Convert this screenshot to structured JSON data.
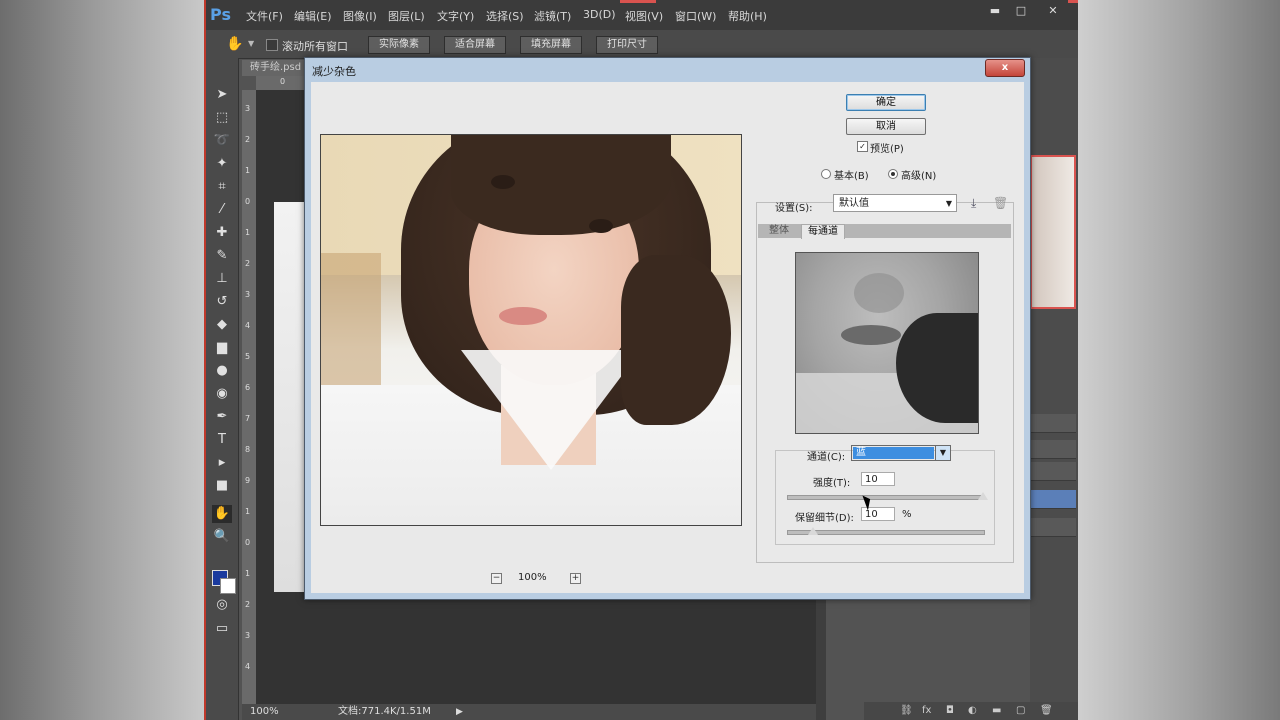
{
  "app": {
    "logo": "Ps",
    "menu": [
      "文件(F)",
      "编辑(E)",
      "图像(I)",
      "图层(L)",
      "文字(Y)",
      "选择(S)",
      "滤镜(T)",
      "3D(D)",
      "视图(V)",
      "窗口(W)",
      "帮助(H)"
    ],
    "window_controls": [
      "▬",
      "□",
      "✕"
    ]
  },
  "options_bar": {
    "scroll_all_label": "滚动所有窗口",
    "buttons": [
      "实际像素",
      "适合屏幕",
      "填充屏幕",
      "打印尺寸"
    ]
  },
  "document": {
    "tab_label": "砖手绘.psd",
    "ruler_v_ticks": [
      "3",
      "2",
      "1",
      "0",
      "1",
      "2",
      "3",
      "4",
      "5",
      "6",
      "7",
      "8",
      "9",
      "1",
      "0",
      "1",
      "2",
      "3",
      "4"
    ],
    "ruler_h_first": "0"
  },
  "status_bar": {
    "zoom": "100%",
    "doc_info": "文档:771.4K/1.51M",
    "arrow": "▶"
  },
  "dialog": {
    "title": "减少杂色",
    "close_label": "x",
    "ok_label": "确定",
    "cancel_label": "取消",
    "preview_label": "预览(P)",
    "preview_checked": true,
    "mode_basic_label": "基本(B)",
    "mode_advanced_label": "高级(N)",
    "mode_selected": "advanced",
    "settings_label": "设置(S):",
    "settings_value": "默认值",
    "tabs": [
      "整体",
      "每通道"
    ],
    "active_tab": "每通道",
    "channel_label": "通道(C):",
    "channel_value": "蓝",
    "strength_label": "强度(T):",
    "strength_value": "10",
    "strength_fraction": 1.0,
    "preserve_label": "保留细节(D):",
    "preserve_value": "10",
    "preserve_unit": "%",
    "preserve_fraction": 0.1,
    "zoom_value": "100%",
    "zoom_minus": "−",
    "zoom_plus": "+"
  }
}
